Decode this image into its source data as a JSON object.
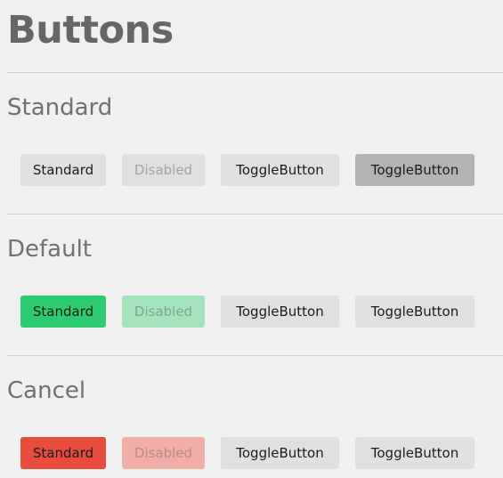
{
  "page": {
    "title": "Buttons"
  },
  "sections": [
    {
      "title": "Standard",
      "buttons": {
        "standard": "Standard",
        "disabled": "Disabled",
        "toggle": "ToggleButton",
        "toggle_selected": "ToggleButton"
      }
    },
    {
      "title": "Default",
      "buttons": {
        "standard": "Standard",
        "disabled": "Disabled",
        "toggle": "ToggleButton",
        "toggle_selected": "ToggleButton"
      }
    },
    {
      "title": "Cancel",
      "buttons": {
        "standard": "Standard",
        "disabled": "Disabled",
        "toggle": "ToggleButton",
        "toggle_selected": "ToggleButton"
      }
    }
  ],
  "colors": {
    "background": "#f0f0f0",
    "button_gray": "#e0e0e0",
    "toggle_selected_gray": "#b3b3b3",
    "default_green": "#2ecc71",
    "default_green_disabled": "#a3e4bc",
    "cancel_red": "#e74c3c",
    "cancel_red_disabled": "#f1aea6"
  }
}
